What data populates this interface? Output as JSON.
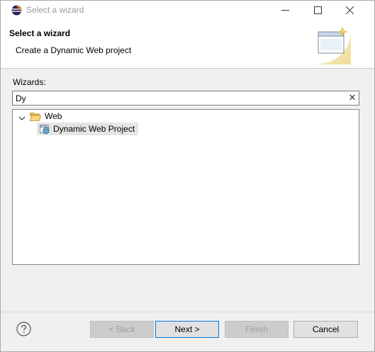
{
  "window": {
    "title": "Select a wizard",
    "app_icon": "eclipse-icon",
    "controls": [
      "minimize-icon",
      "maximize-icon",
      "close-icon"
    ]
  },
  "banner": {
    "title": "Select a wizard",
    "description": "Create a Dynamic Web project",
    "graphic": "new-wizard-banner-icon"
  },
  "wizards": {
    "label": "Wizards:",
    "filter_value": "Dy",
    "clear_icon": "clear-icon",
    "tree": [
      {
        "label": "Web",
        "icon": "folder-open-icon",
        "expanded": true,
        "children": [
          {
            "label": "Dynamic Web Project",
            "icon": "dynamic-web-project-icon",
            "selected": true
          }
        ]
      }
    ]
  },
  "footer": {
    "help_icon": "help-icon",
    "back_label": "< Back",
    "next_label": "Next >",
    "finish_label": "Finish",
    "cancel_label": "Cancel",
    "back_enabled": false,
    "finish_enabled": false
  },
  "colors": {
    "window_bg": "#f0f0f0",
    "banner_bg": "#ffffff",
    "selection_bg": "#e5e5e5",
    "default_button_border": "#0078d7",
    "title_text": "#999999"
  }
}
